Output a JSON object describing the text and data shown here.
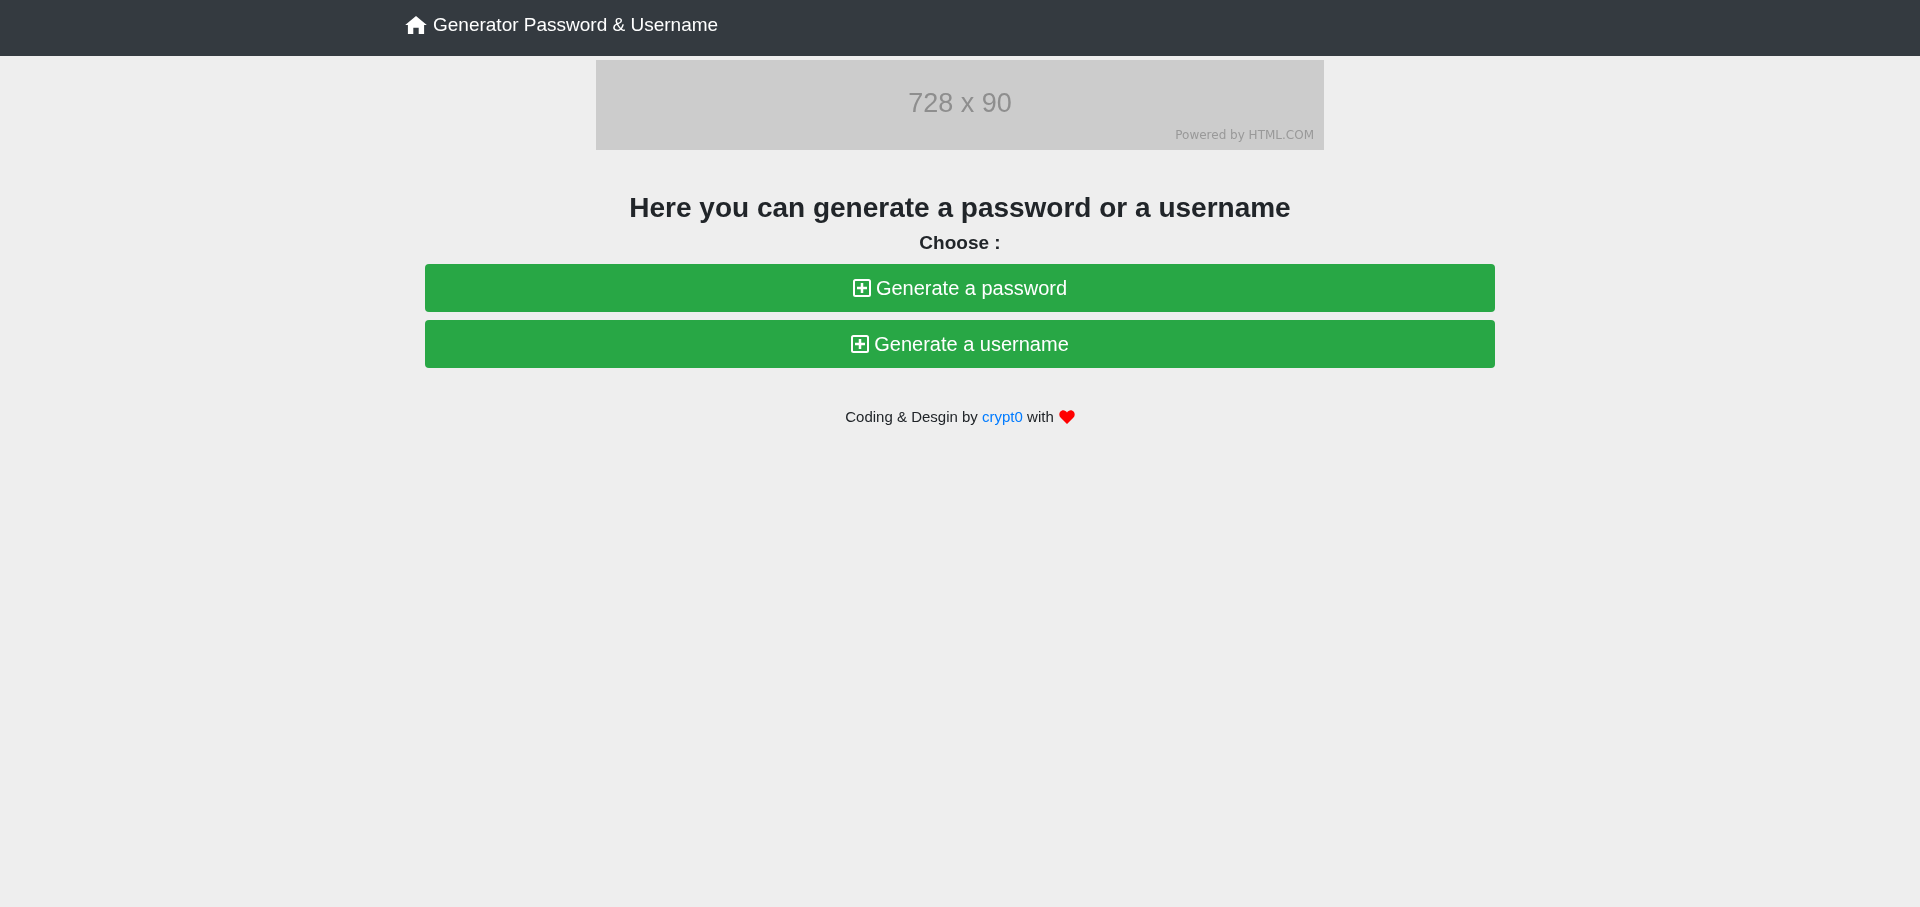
{
  "navbar": {
    "brand": "Generator Password & Username"
  },
  "ad_banner": {
    "size": "728 x 90",
    "credit": "Powered by HTML.COM"
  },
  "heading": "Here you can generate a password or a username",
  "prompt": "Choose :",
  "buttons": [
    {
      "label": "Generate a password"
    },
    {
      "label": "Generate a username"
    }
  ],
  "footer": {
    "before": "Coding & Desgin by",
    "link": "crypt0",
    "after": "with"
  }
}
